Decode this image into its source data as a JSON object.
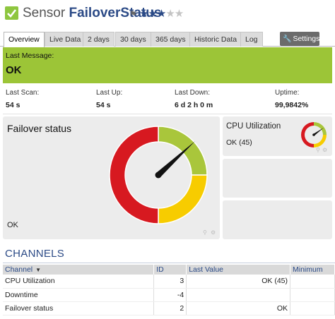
{
  "header": {
    "prefix": "Sensor",
    "name": "FailoverStatus",
    "priority_stars": 3,
    "priority_max": 5
  },
  "tabs": [
    {
      "label": "Overview",
      "active": true
    },
    {
      "label": "Live Data"
    },
    {
      "label": "2 days"
    },
    {
      "label": "30 days"
    },
    {
      "label": "365 days"
    },
    {
      "label": "Historic Data"
    },
    {
      "label": "Log"
    }
  ],
  "settings_label": "Settings",
  "last_message": {
    "label": "Last Message:",
    "value": "OK"
  },
  "stats": [
    {
      "label": "Last Scan:",
      "value": "54 s"
    },
    {
      "label": "Last Up:",
      "value": "54 s"
    },
    {
      "label": "Last Down:",
      "value": "6 d 2 h 0 m"
    },
    {
      "label": "Uptime:",
      "value": "99,9842%"
    }
  ],
  "main_gauge": {
    "title": "Failover status",
    "value_text": "OK"
  },
  "cpu_gauge": {
    "title": "CPU Utilization",
    "value_text": "OK (45)"
  },
  "channels": {
    "title": "CHANNELS",
    "columns": [
      "Channel",
      "ID",
      "Last Value",
      "Minimum"
    ],
    "rows": [
      {
        "channel": "CPU Utilization",
        "id": "3",
        "last_value": "OK (45)",
        "minimum": ""
      },
      {
        "channel": "Downtime",
        "id": "-4",
        "last_value": "",
        "minimum": ""
      },
      {
        "channel": "Failover status",
        "id": "2",
        "last_value": "OK",
        "minimum": ""
      }
    ]
  },
  "colors": {
    "accent_green": "#9cc537",
    "brand_blue": "#2b4a86",
    "gauge_red": "#d71920",
    "gauge_yellow": "#f7cc00",
    "gauge_green": "#a9c63b"
  }
}
